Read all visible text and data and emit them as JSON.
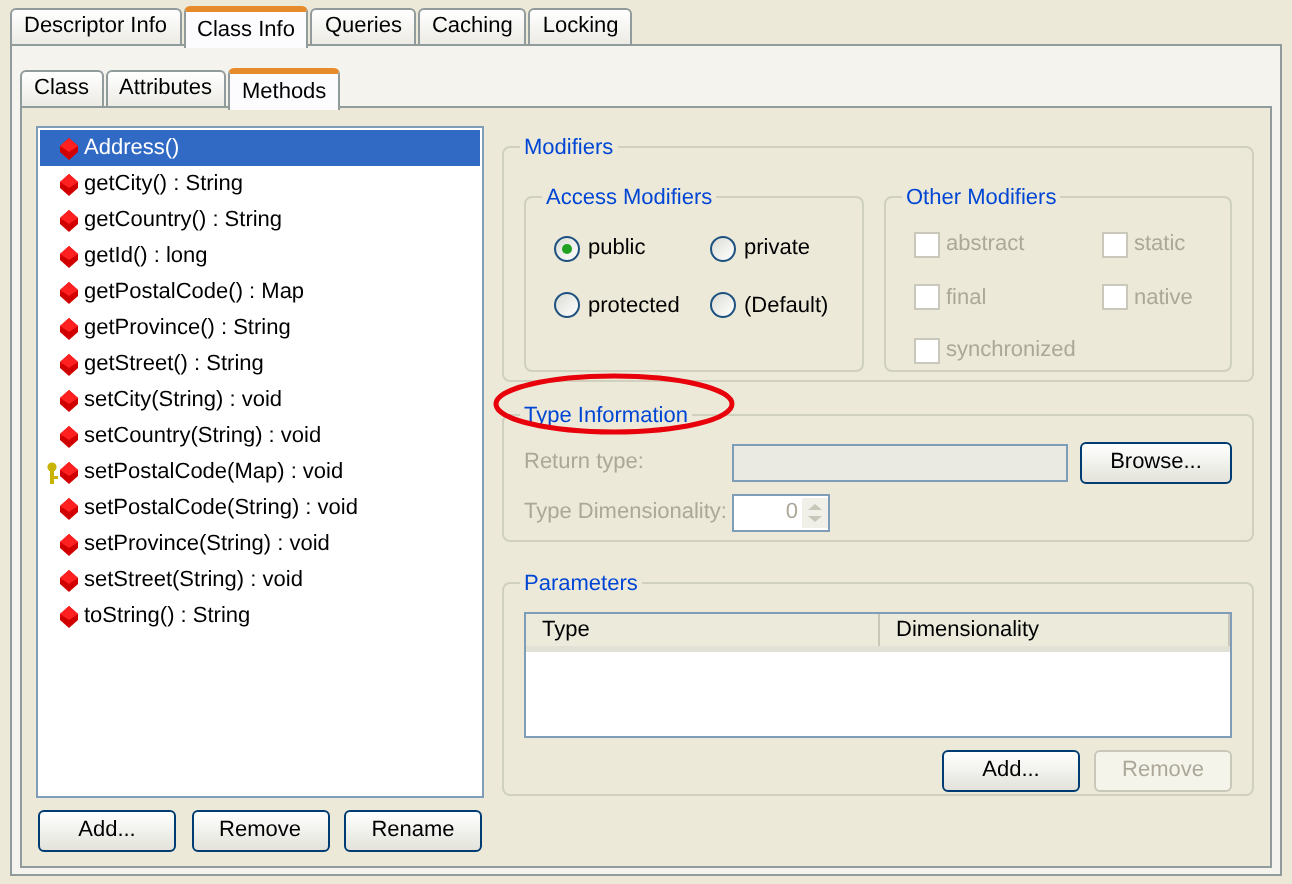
{
  "top_tabs": [
    {
      "label": "Descriptor Info",
      "selected": false
    },
    {
      "label": "Class Info",
      "selected": true
    },
    {
      "label": "Queries",
      "selected": false
    },
    {
      "label": "Caching",
      "selected": false
    },
    {
      "label": "Locking",
      "selected": false
    }
  ],
  "sub_tabs": [
    {
      "label": "Class",
      "selected": false
    },
    {
      "label": "Attributes",
      "selected": false
    },
    {
      "label": "Methods",
      "selected": true
    }
  ],
  "methods": [
    {
      "label": "Address()",
      "selected": true,
      "kind": "plain"
    },
    {
      "label": "getCity() : String",
      "selected": false,
      "kind": "plain"
    },
    {
      "label": "getCountry() : String",
      "selected": false,
      "kind": "plain"
    },
    {
      "label": "getId() : long",
      "selected": false,
      "kind": "plain"
    },
    {
      "label": "getPostalCode() : Map",
      "selected": false,
      "kind": "plain"
    },
    {
      "label": "getProvince() : String",
      "selected": false,
      "kind": "plain"
    },
    {
      "label": "getStreet() : String",
      "selected": false,
      "kind": "plain"
    },
    {
      "label": "setCity(String) : void",
      "selected": false,
      "kind": "plain"
    },
    {
      "label": "setCountry(String) : void",
      "selected": false,
      "kind": "plain"
    },
    {
      "label": "setPostalCode(Map) : void",
      "selected": false,
      "kind": "keyed"
    },
    {
      "label": "setPostalCode(String) : void",
      "selected": false,
      "kind": "plain"
    },
    {
      "label": "setProvince(String) : void",
      "selected": false,
      "kind": "plain"
    },
    {
      "label": "setStreet(String) : void",
      "selected": false,
      "kind": "plain"
    },
    {
      "label": "toString() : String",
      "selected": false,
      "kind": "plain"
    }
  ],
  "method_buttons": [
    "Add...",
    "Remove",
    "Rename"
  ],
  "modifiers": {
    "title": "Modifiers",
    "access": {
      "title": "Access Modifiers",
      "options": [
        {
          "label": "public",
          "selected": true
        },
        {
          "label": "private",
          "selected": false
        },
        {
          "label": "protected",
          "selected": false
        },
        {
          "label": "(Default)",
          "selected": false
        }
      ]
    },
    "other": {
      "title": "Other Modifiers",
      "options": [
        {
          "label": "abstract",
          "checked": false,
          "disabled": true
        },
        {
          "label": "static",
          "checked": false,
          "disabled": true
        },
        {
          "label": "final",
          "checked": false,
          "disabled": true
        },
        {
          "label": "native",
          "checked": false,
          "disabled": true
        },
        {
          "label": "synchronized",
          "checked": false,
          "disabled": true
        }
      ]
    }
  },
  "type_information": {
    "title": "Type Information",
    "highlighted": true,
    "disabled": true,
    "return_type_label": "Return type:",
    "browse_button": "Browse...",
    "dimensionality_label": "Type Dimensionality:",
    "dimensionality": "0"
  },
  "parameters": {
    "title": "Parameters",
    "columns": [
      "Type",
      "Dimensionality"
    ],
    "buttons": [
      {
        "label": "Add...",
        "disabled": false
      },
      {
        "label": "Remove",
        "disabled": true
      }
    ]
  }
}
